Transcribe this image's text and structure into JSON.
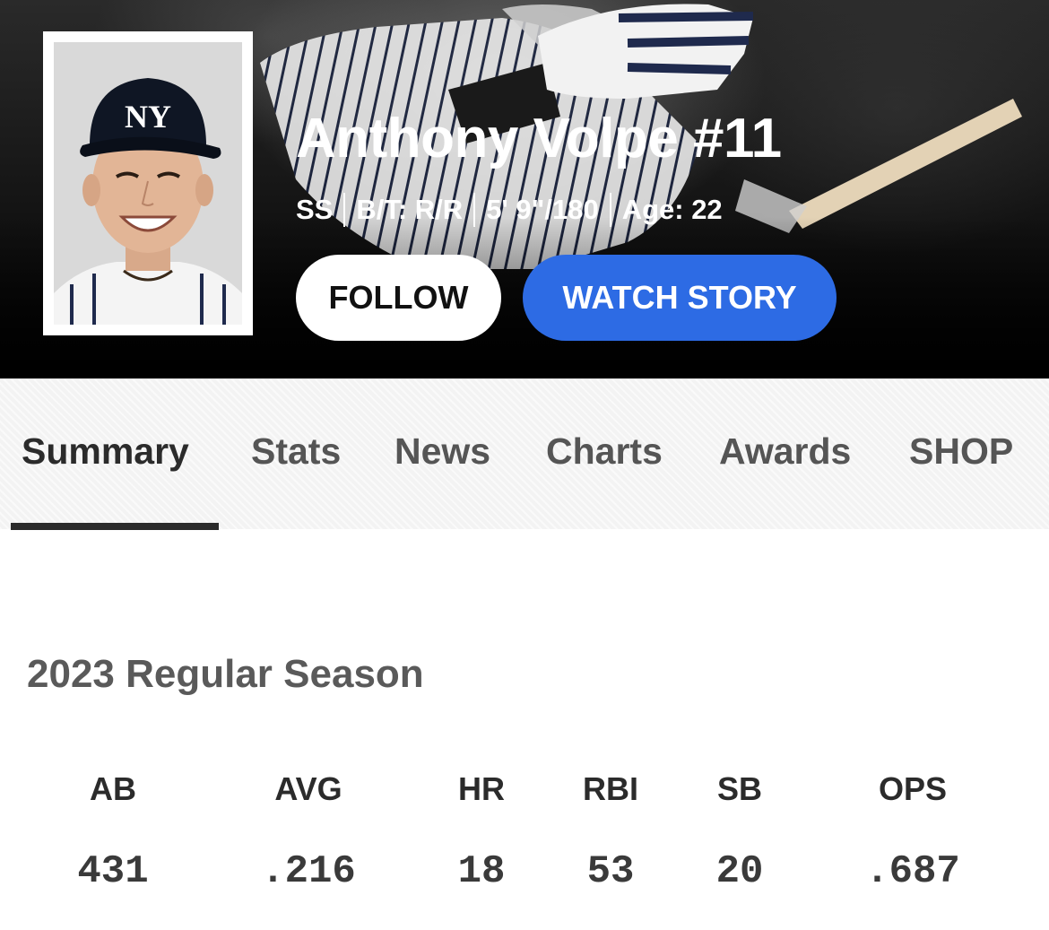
{
  "player": {
    "name": "Anthony Volpe #11",
    "position": "SS",
    "bats_throws": "B/T: R/R",
    "height_weight": "5' 9\"/180",
    "age": "Age: 22",
    "cap_logo": "NY"
  },
  "actions": {
    "follow_label": "FOLLOW",
    "watch_story_label": "WATCH STORY"
  },
  "tabs": {
    "items": [
      {
        "label": "Summary",
        "active": true
      },
      {
        "label": "Stats",
        "active": false
      },
      {
        "label": "News",
        "active": false
      },
      {
        "label": "Charts",
        "active": false
      },
      {
        "label": "Awards",
        "active": false
      },
      {
        "label": "SHOP",
        "active": false
      }
    ]
  },
  "season": {
    "title": "2023 Regular Season",
    "stats": [
      {
        "label": "AB",
        "value": "431"
      },
      {
        "label": "AVG",
        "value": ".216"
      },
      {
        "label": "HR",
        "value": "18"
      },
      {
        "label": "RBI",
        "value": "53"
      },
      {
        "label": "SB",
        "value": "20"
      },
      {
        "label": "OPS",
        "value": ".687"
      }
    ]
  },
  "colors": {
    "watch_button": "#2d6be4",
    "active_tab_indicator": "#2b2b2b"
  }
}
